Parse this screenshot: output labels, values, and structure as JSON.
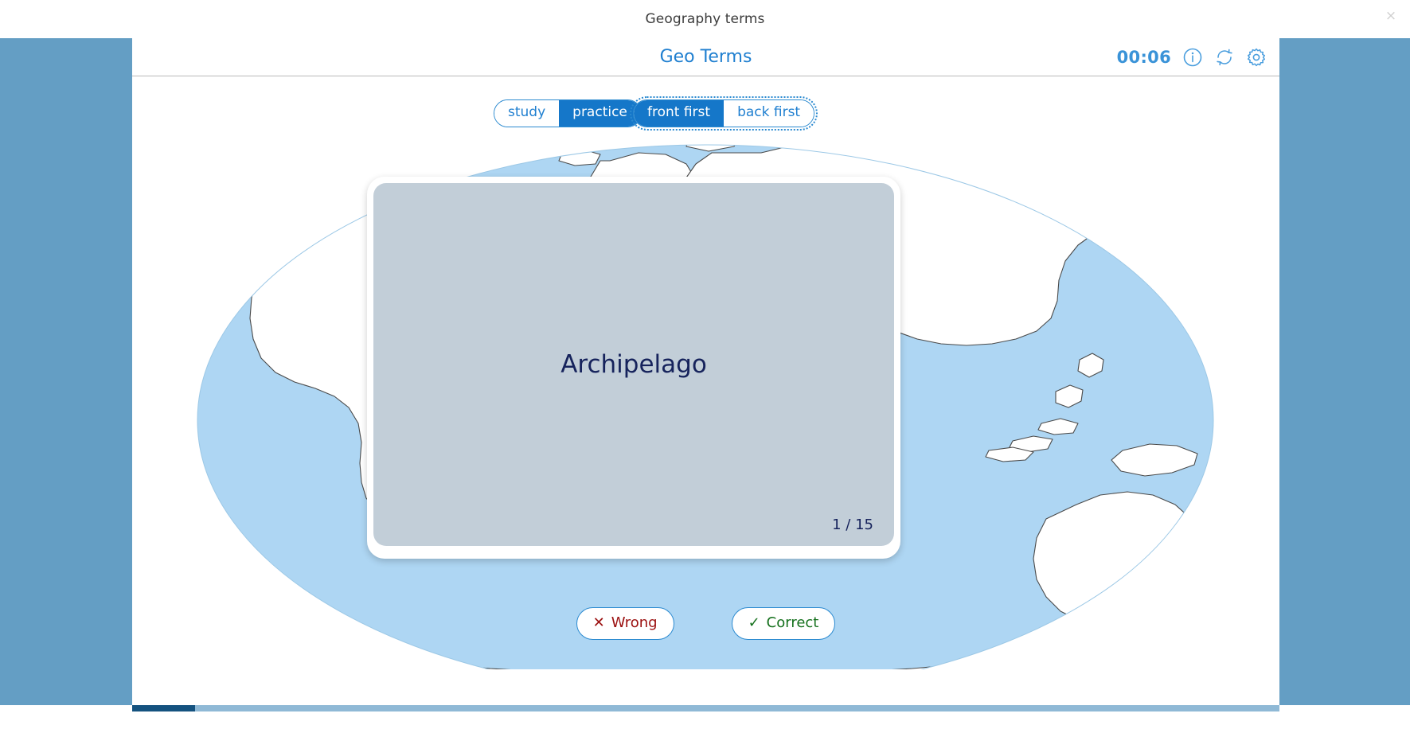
{
  "window": {
    "page_title": "Geography terms",
    "close_label": "×",
    "close_icon": "close-icon"
  },
  "header": {
    "deck_title": "Geo Terms",
    "timer": "00:06",
    "icons": [
      {
        "name": "info-icon",
        "title": "info"
      },
      {
        "name": "shuffle-refresh-icon",
        "title": "restart"
      },
      {
        "name": "gear-icon",
        "title": "settings"
      }
    ]
  },
  "toggles": {
    "mode": {
      "name": "mode-toggle",
      "focused": false,
      "options": [
        {
          "label": "study",
          "active": false
        },
        {
          "label": "practice",
          "active": true
        }
      ]
    },
    "side": {
      "name": "side-toggle",
      "focused": true,
      "options": [
        {
          "label": "front first",
          "active": true
        },
        {
          "label": "back first",
          "active": false
        }
      ]
    }
  },
  "card": {
    "term": "Archipelago",
    "counter": "1 / 15",
    "current": 1,
    "total": 15,
    "face": "front"
  },
  "answers": {
    "wrong": {
      "mark": "✕",
      "label": "Wrong"
    },
    "correct": {
      "mark": "✓",
      "label": "Correct"
    }
  },
  "progress": {
    "percent": 5.5,
    "fill_color": "#14527f",
    "track_color": "#8fb9d6"
  },
  "colors": {
    "app_background": "#649ec4",
    "content_background": "#ffffff",
    "accent_blue": "#1f7fd0",
    "active_blue": "#1577c9",
    "ocean": "#aed6f3",
    "land": "#ffffff",
    "land_outline": "#3c3c3c",
    "card_face": "#c2ced8",
    "card_text": "#16235c",
    "timer_blue": "#3a93d8",
    "wrong_red": "#9b1010",
    "correct_green": "#14701c"
  },
  "map": {
    "name": "world-map-illustration",
    "projection": "robinson-globe",
    "ocean_label": "ocean",
    "land_label": "landmasses"
  }
}
